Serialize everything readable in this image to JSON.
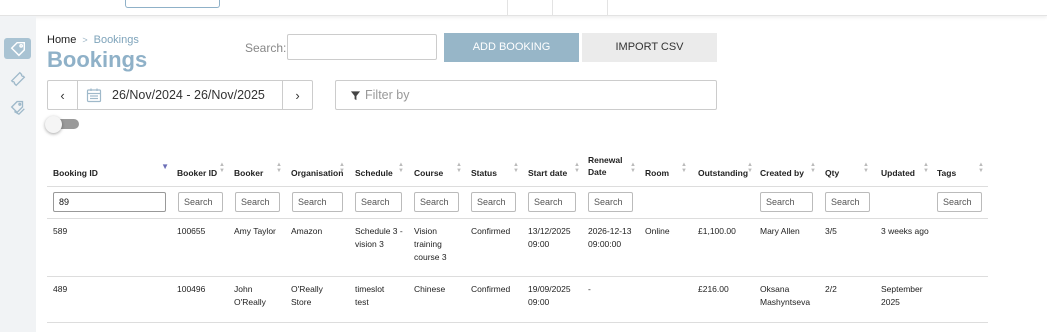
{
  "breadcrumb": {
    "home": "Home",
    "separator": ">",
    "current": "Bookings"
  },
  "page_title": "Bookings",
  "search": {
    "label": "Search:",
    "value": ""
  },
  "buttons": {
    "add_booking": "ADD BOOKING",
    "import_csv": "IMPORT CSV"
  },
  "date_range": {
    "prev": "‹",
    "value": "26/Nov/2024 - 26/Nov/2025",
    "next": "›"
  },
  "filter": {
    "placeholder": "Filter by"
  },
  "toggle": {
    "on": false
  },
  "colors": {
    "accent": "#8fb1c8",
    "button_primary": "#97b6c8",
    "sort_active": "#6c6fb7",
    "sidebar": "#f1f3f5"
  },
  "sidebar": {
    "items": [
      {
        "icon": "tag-icon",
        "active": true
      },
      {
        "icon": "ticket-icon",
        "active": false
      },
      {
        "icon": "tags-icon",
        "active": false
      }
    ]
  },
  "table": {
    "headers": [
      "Booking ID",
      "Booker ID",
      "Booker",
      "Organisation",
      "Schedule",
      "Course",
      "Status",
      "Start date",
      "Renewal Date",
      "Room",
      "Outstanding",
      "Created by",
      "Qty",
      "Updated",
      "Tags"
    ],
    "sorted_column": "Booking ID",
    "search_placeholder": "Search",
    "booking_id_search_value": "89",
    "rows": [
      [
        "589",
        "100655",
        "Amy Taylor",
        "Amazon",
        "Schedule 3 - vision 3",
        "Vision training course 3",
        "Confirmed",
        "13/12/2025 09:00",
        "2026-12-13 09:00:00",
        "Online",
        "£1,100.00",
        "Mary Allen",
        "3/5",
        "3 weeks ago",
        ""
      ],
      [
        "489",
        "100496",
        "John O'Really",
        "O'Really Store",
        "timeslot test",
        "Chinese",
        "Confirmed",
        "19/09/2025 09:00",
        "-",
        "",
        "£216.00",
        "Oksana Mashyntseva",
        "2/2",
        "September 2025",
        ""
      ]
    ]
  }
}
